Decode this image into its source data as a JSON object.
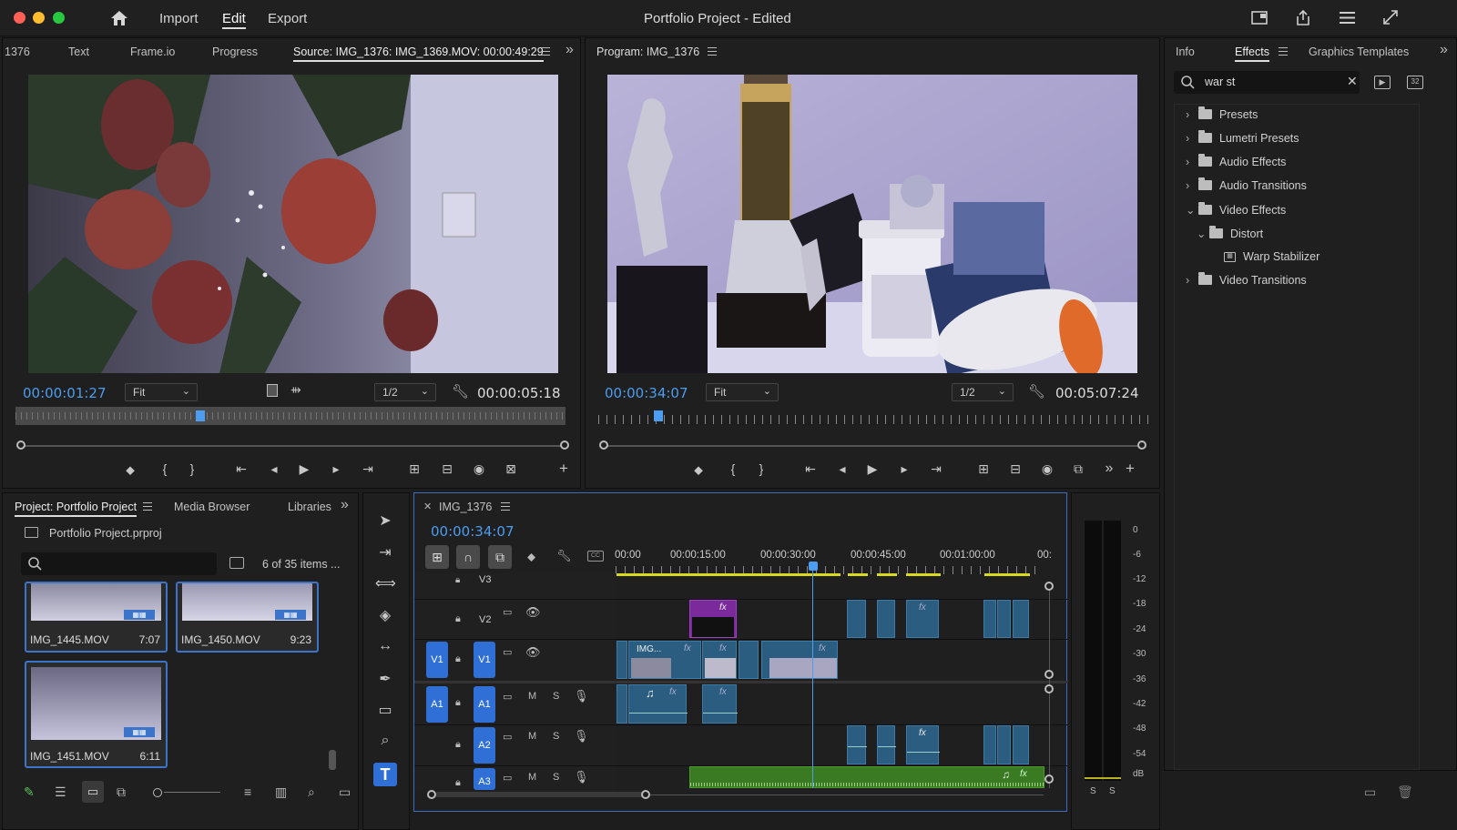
{
  "window": {
    "title": "Portfolio Project",
    "title_suffix": " - Edited"
  },
  "menu": {
    "import": "Import",
    "edit": "Edit",
    "export": "Export"
  },
  "source_panel": {
    "tabs": [
      "1376",
      "Text",
      "Frame.io",
      "Progress"
    ],
    "active_tab": "Source: IMG_1376: IMG_1369.MOV: 00:00:49:29",
    "timecode": "00:00:01:27",
    "fit": "Fit",
    "resolution": "1/2",
    "duration": "00:00:05:18"
  },
  "program_panel": {
    "title": "Program: IMG_1376",
    "timecode": "00:00:34:07",
    "fit": "Fit",
    "resolution": "1/2",
    "duration": "00:05:07:24"
  },
  "effects_panel": {
    "tabs": [
      "Info",
      "Effects",
      "Graphics Templates"
    ],
    "search_value": "war st",
    "tree": [
      {
        "label": "Presets",
        "expanded": false,
        "icon": "preset-folder-icon",
        "depth": 0
      },
      {
        "label": "Lumetri Presets",
        "expanded": false,
        "icon": "preset-folder-icon",
        "depth": 0
      },
      {
        "label": "Audio Effects",
        "expanded": false,
        "icon": "folder-icon",
        "depth": 0
      },
      {
        "label": "Audio Transitions",
        "expanded": false,
        "icon": "folder-icon",
        "depth": 0
      },
      {
        "label": "Video Effects",
        "expanded": true,
        "icon": "folder-icon",
        "depth": 0
      },
      {
        "label": "Distort",
        "expanded": true,
        "icon": "folder-icon",
        "depth": 1
      },
      {
        "label": "Warp Stabilizer",
        "expanded": null,
        "icon": "effect-icon",
        "depth": 2
      },
      {
        "label": "Video Transitions",
        "expanded": false,
        "icon": "folder-icon",
        "depth": 0
      }
    ]
  },
  "project_panel": {
    "tabs": [
      "Project: Portfolio Project",
      "Media Browser",
      "Libraries"
    ],
    "file": "Portfolio Project.prproj",
    "search_placeholder": "",
    "items_count": "6 of 35 items ...",
    "clips": [
      {
        "name": "IMG_1445.MOV",
        "duration": "7:07"
      },
      {
        "name": "IMG_1450.MOV",
        "duration": "9:23"
      },
      {
        "name": "IMG_1451.MOV",
        "duration": "6:11"
      }
    ]
  },
  "timeline": {
    "sequence": "IMG_1376",
    "timecode": "00:00:34:07",
    "ruler": [
      "00:00",
      "00:00:15:00",
      "00:00:30:00",
      "00:00:45:00",
      "00:01:00:00",
      "00:"
    ],
    "tracks": {
      "video": [
        "V3",
        "V2",
        "V1"
      ],
      "audio": [
        "A1",
        "A2",
        "A3"
      ],
      "source_v": "V1",
      "source_a": "A1",
      "mute": "M",
      "solo": "S"
    },
    "clip_labels": {
      "v1_first": "IMG...",
      "fx": "fx"
    }
  },
  "audio_meter": {
    "scale": [
      "0",
      "-6",
      "-12",
      "-18",
      "-24",
      "-30",
      "-36",
      "-42",
      "-48",
      "-54",
      "dB"
    ],
    "channels": [
      "S",
      "S"
    ]
  },
  "colors": {
    "accent": "#4c9cf0",
    "bg": "#1d1d1d",
    "panel": "#1f1f1f",
    "clip_video": "#2a5d80",
    "clip_purple": "#7a2a9a",
    "clip_green": "#3a7a22",
    "selection": "#2f6fd6",
    "ruler_yellow": "#d8d81e"
  }
}
